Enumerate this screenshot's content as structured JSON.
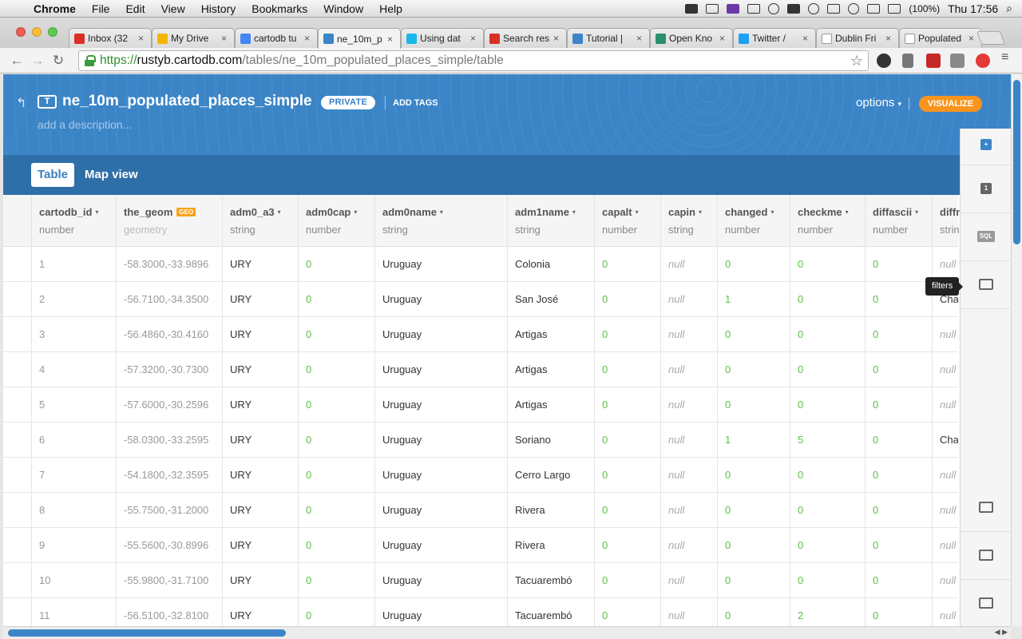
{
  "menubar": {
    "app": "Chrome",
    "items": [
      "File",
      "Edit",
      "View",
      "History",
      "Bookmarks",
      "Window",
      "Help"
    ],
    "battery": "(100%)",
    "clock": "Thu 17:56"
  },
  "tabs": [
    {
      "title": "Inbox (32",
      "icon": "gmail-icon",
      "color": "#d93025"
    },
    {
      "title": "My Drive",
      "icon": "drive-icon",
      "color": "#f4b400"
    },
    {
      "title": "cartodb tu",
      "icon": "docs-icon",
      "color": "#4285f4"
    },
    {
      "title": "ne_10m_p",
      "icon": "cartodb-icon",
      "color": "#3b85c7",
      "active": true
    },
    {
      "title": "Using dat",
      "icon": "vimeo-icon",
      "color": "#1ab7ea"
    },
    {
      "title": "Search res",
      "icon": "gmail-icon",
      "color": "#d93025"
    },
    {
      "title": "Tutorial |",
      "icon": "cartodb-icon",
      "color": "#3b85c7"
    },
    {
      "title": "Open Kno",
      "icon": "okfn-icon",
      "color": "#2a8f6a"
    },
    {
      "title": "Twitter /",
      "icon": "twitter-icon",
      "color": "#1da1f2"
    },
    {
      "title": "Dublin Fri",
      "icon": "page-icon",
      "color": "#ffffff"
    },
    {
      "title": "Populated",
      "icon": "page-icon",
      "color": "#ffffff"
    }
  ],
  "address": {
    "scheme": "https://",
    "host": "rustyb.cartodb.com",
    "path": "/tables/ne_10m_populated_places_simple/table"
  },
  "header": {
    "table_icon": "T",
    "table_name": "ne_10m_populated_places_simple",
    "privacy": "PRIVATE",
    "add_tags": "ADD TAGS",
    "description_placeholder": "add a description...",
    "options": "options",
    "visualize": "VISUALIZE"
  },
  "view_tabs": {
    "table": "Table",
    "map": "Map view"
  },
  "columns": [
    {
      "name": "cartodb_id",
      "type": "number"
    },
    {
      "name": "the_geom",
      "type": "geometry",
      "badge": "GEO"
    },
    {
      "name": "adm0_a3",
      "type": "string"
    },
    {
      "name": "adm0cap",
      "type": "number"
    },
    {
      "name": "adm0name",
      "type": "string"
    },
    {
      "name": "adm1name",
      "type": "string"
    },
    {
      "name": "capalt",
      "type": "number"
    },
    {
      "name": "capin",
      "type": "string"
    },
    {
      "name": "changed",
      "type": "number"
    },
    {
      "name": "checkme",
      "type": "number"
    },
    {
      "name": "diffascii",
      "type": "number"
    },
    {
      "name": "diffnote",
      "type": "string"
    }
  ],
  "rows": [
    [
      "1",
      "-58.3000,-33.9896",
      "URY",
      "0",
      "Uruguay",
      "Colonia",
      "0",
      "null",
      "0",
      "0",
      "0",
      "null"
    ],
    [
      "2",
      "-56.7100,-34.3500",
      "URY",
      "0",
      "Uruguay",
      "San José",
      "0",
      "null",
      "1",
      "0",
      "0",
      "Changed"
    ],
    [
      "3",
      "-56.4860,-30.4160",
      "URY",
      "0",
      "Uruguay",
      "Artigas",
      "0",
      "null",
      "0",
      "0",
      "0",
      "null"
    ],
    [
      "4",
      "-57.3200,-30.7300",
      "URY",
      "0",
      "Uruguay",
      "Artigas",
      "0",
      "null",
      "0",
      "0",
      "0",
      "null"
    ],
    [
      "5",
      "-57.6000,-30.2596",
      "URY",
      "0",
      "Uruguay",
      "Artigas",
      "0",
      "null",
      "0",
      "0",
      "0",
      "null"
    ],
    [
      "6",
      "-58.0300,-33.2595",
      "URY",
      "0",
      "Uruguay",
      "Soriano",
      "0",
      "null",
      "1",
      "5",
      "0",
      "Changed"
    ],
    [
      "7",
      "-54.1800,-32.3595",
      "URY",
      "0",
      "Uruguay",
      "Cerro Largo",
      "0",
      "null",
      "0",
      "0",
      "0",
      "null"
    ],
    [
      "8",
      "-55.7500,-31.2000",
      "URY",
      "0",
      "Uruguay",
      "Rivera",
      "0",
      "null",
      "0",
      "0",
      "0",
      "null"
    ],
    [
      "9",
      "-55.5600,-30.8996",
      "URY",
      "0",
      "Uruguay",
      "Rivera",
      "0",
      "null",
      "0",
      "0",
      "0",
      "null"
    ],
    [
      "10",
      "-55.9800,-31.7100",
      "URY",
      "0",
      "Uruguay",
      "Tacuarembó",
      "0",
      "null",
      "0",
      "0",
      "0",
      "null"
    ],
    [
      "11",
      "-56.5100,-32.8100",
      "URY",
      "0",
      "Uruguay",
      "Tacuarembó",
      "0",
      "null",
      "0",
      "2",
      "0",
      "null"
    ]
  ],
  "right_panel": {
    "items": [
      {
        "name": "add-layer-button",
        "icon": "plus-icon",
        "label": "+"
      },
      {
        "name": "layer-1-button",
        "icon": "layer-icon",
        "label": "1"
      },
      {
        "name": "sql-button",
        "icon": "sql-icon",
        "label": "SQL"
      },
      {
        "name": "filters-button",
        "icon": "histogram-icon",
        "label": ""
      },
      {
        "name": "merge-button",
        "icon": "merge-icon",
        "label": ""
      },
      {
        "name": "add-row-button",
        "icon": "add-row-icon",
        "label": ""
      },
      {
        "name": "add-column-button",
        "icon": "add-column-icon",
        "label": ""
      }
    ],
    "tooltip": "filters"
  }
}
